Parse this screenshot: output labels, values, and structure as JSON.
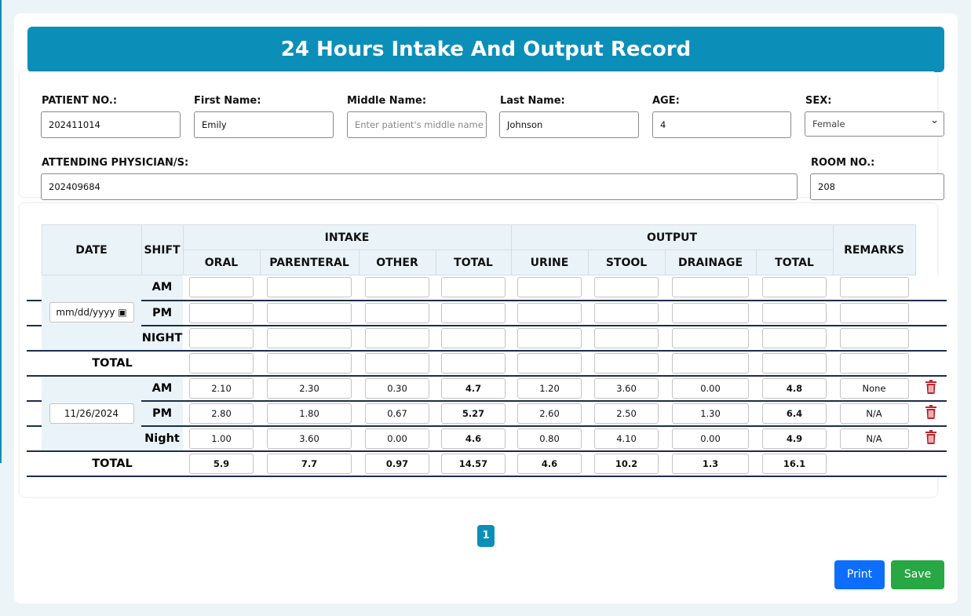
{
  "title": "24 Hours Intake And Output Record",
  "patient": {
    "patient_no_label": "PATIENT NO.:",
    "patient_no": "202411014",
    "first_name_label": "First Name:",
    "first_name": "Emily",
    "middle_name_label": "Middle Name:",
    "middle_name_placeholder": "Enter patient's middle name",
    "last_name_label": "Last Name:",
    "last_name": "Johnson",
    "age_label": "AGE:",
    "age": "4",
    "sex_label": "SEX:",
    "sex": "Female",
    "physician_label": "ATTENDING PHYSICIAN/S:",
    "physician": "202409684",
    "room_label": "ROOM NO.:",
    "room": "208"
  },
  "table": {
    "headers": {
      "date": "DATE",
      "shift": "SHIFT",
      "intake": "INTAKE",
      "output": "OUTPUT",
      "remarks": "REMARKS",
      "oral": "ORAL",
      "parenteral": "PARENTERAL",
      "other": "OTHER",
      "intake_total": "TOTAL",
      "urine": "URINE",
      "stool": "STOOL",
      "drainage": "DRAINAGE",
      "output_total": "TOTAL"
    },
    "blank_date": "mm/dd/yyyy",
    "blank_shifts": [
      "AM",
      "PM",
      "NIGHT"
    ],
    "total_label": "TOTAL",
    "date": "11/26/2024",
    "rows": [
      {
        "shift": "AM",
        "oral": "2.10",
        "parenteral": "2.30",
        "other": "0.30",
        "intake_total": "4.7",
        "urine": "1.20",
        "stool": "3.60",
        "drainage": "0.00",
        "output_total": "4.8",
        "remarks": "None"
      },
      {
        "shift": "PM",
        "oral": "2.80",
        "parenteral": "1.80",
        "other": "0.67",
        "intake_total": "5.27",
        "urine": "2.60",
        "stool": "2.50",
        "drainage": "1.30",
        "output_total": "6.4",
        "remarks": "N/A"
      },
      {
        "shift": "Night",
        "oral": "1.00",
        "parenteral": "3.60",
        "other": "0.00",
        "intake_total": "4.6",
        "urine": "0.80",
        "stool": "4.10",
        "drainage": "0.00",
        "output_total": "4.9",
        "remarks": "N/A"
      }
    ],
    "totals": {
      "oral": "5.9",
      "parenteral": "7.7",
      "other": "0.97",
      "intake_total": "14.57",
      "urine": "4.6",
      "stool": "10.2",
      "drainage": "1.3",
      "output_total": "16.1"
    }
  },
  "pagination": {
    "current": "1"
  },
  "buttons": {
    "print": "Print",
    "save": "Save"
  },
  "colors": {
    "primary": "#0b8fb8",
    "print": "#0d6efd",
    "save": "#28a745",
    "delete": "#c0262d"
  }
}
